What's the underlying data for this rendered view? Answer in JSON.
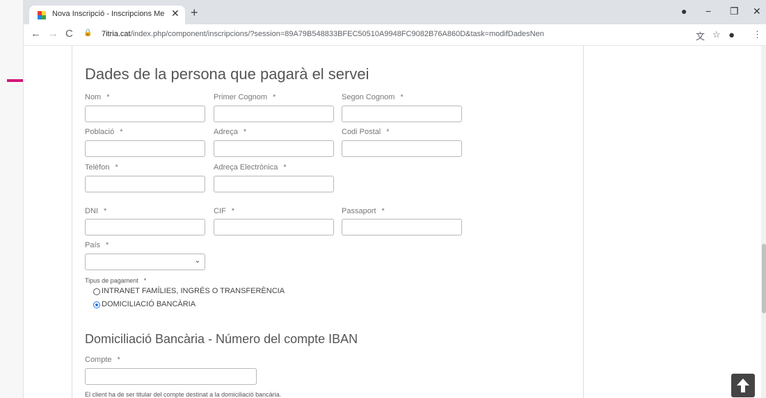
{
  "browser": {
    "tab_title": "Nova Inscripció - Inscripcions Me",
    "url_host": "7itria.cat",
    "url_path": "/index.php/component/inscripcions/?session=89A79B548833BFEC50510A9948FC9082B76A860D&task=modifDadesNen"
  },
  "form": {
    "heading": "Dades de la persona que pagarà el servei",
    "required_mark": "*",
    "labels": {
      "nom": "Nom",
      "primer_cognom": "Primer Cognom",
      "segon_cognom": "Segon Cognom",
      "poblacio": "Població",
      "adreca": "Adreça",
      "codi_postal": "Codi Postal",
      "telefon": "Telèfon",
      "adreca_electronica": "Adreça Electrònica",
      "dni": "DNI",
      "cif": "CIF",
      "passaport": "Passaport",
      "pais": "País",
      "tipus_pagament": "Tipus de pagament"
    },
    "payment_options": [
      {
        "label": "INTRANET FAMÍLIES, INGRÉS O TRANSFERÈNCIA",
        "selected": false
      },
      {
        "label": "DOMICILIACIÓ BANCÀRIA",
        "selected": true
      }
    ]
  },
  "bank": {
    "heading": "Domiciliació Bancària - Número del compte IBAN",
    "compte_label": "Compte",
    "note": "El client ha de ser titular del compte destinat a la domiciliació bancària."
  },
  "colors": {
    "annotation_arrow": "#d6157a",
    "radio_accent": "#1a73e8"
  }
}
